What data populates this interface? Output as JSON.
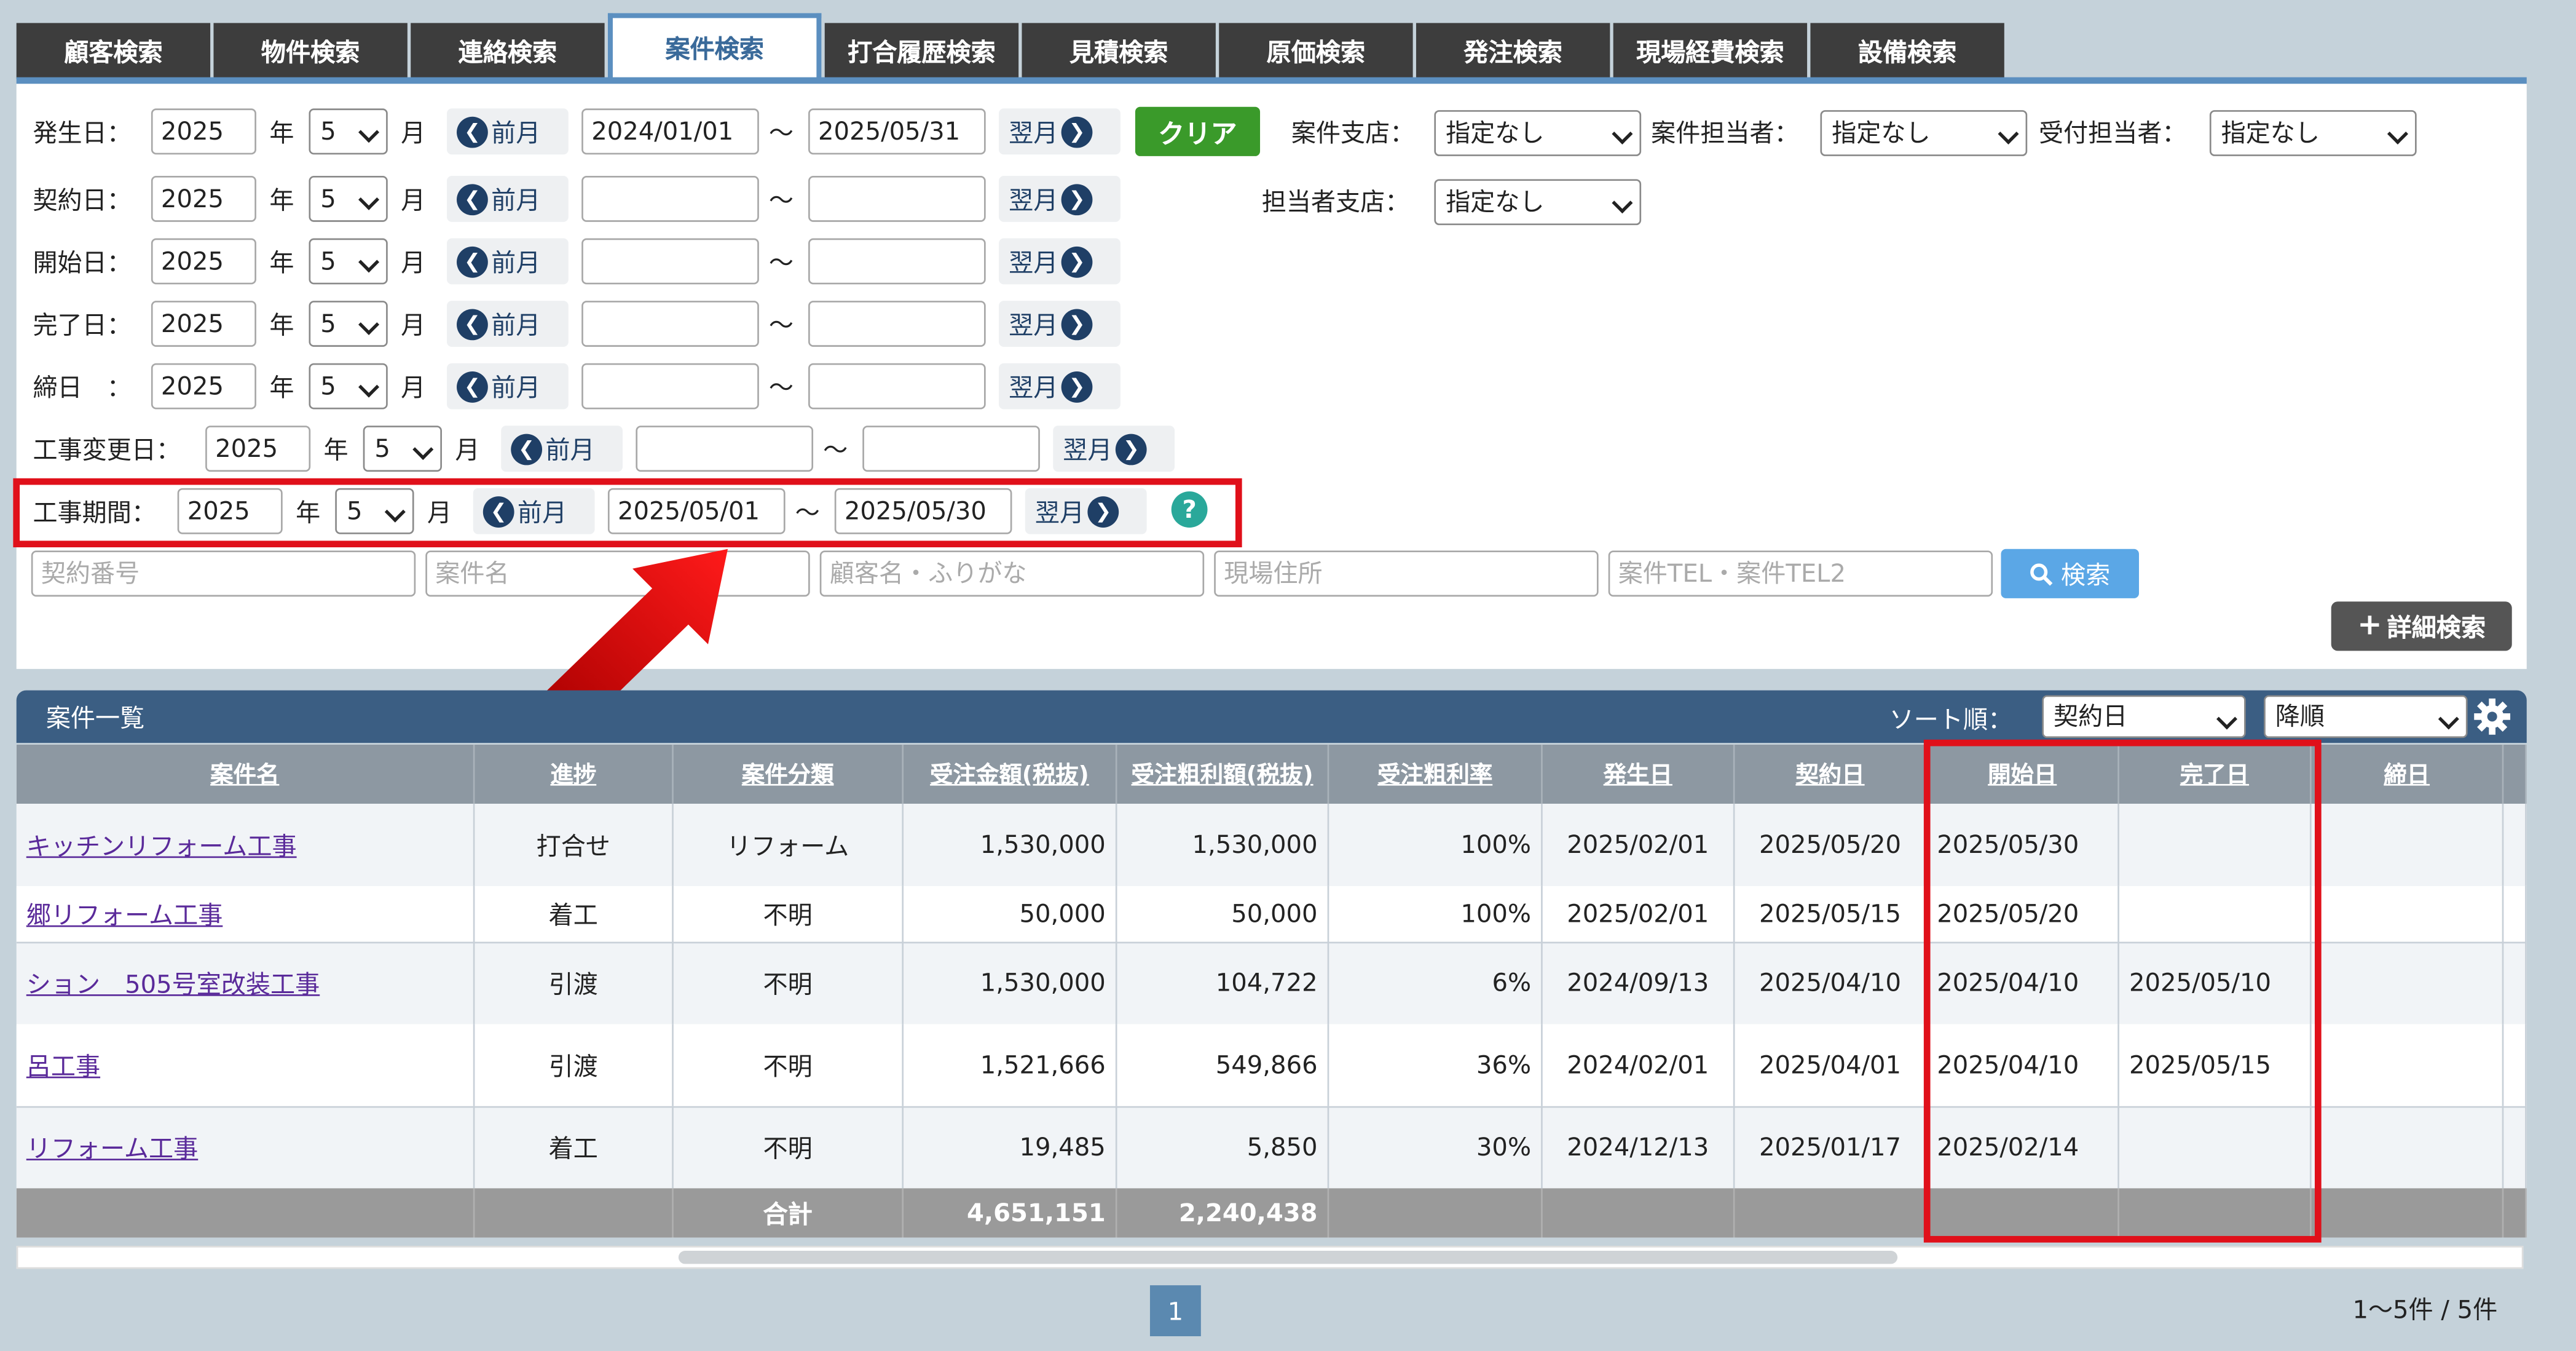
{
  "tabs": [
    "顧客検索",
    "物件検索",
    "連絡検索",
    "案件検索",
    "打合履歴検索",
    "見積検索",
    "原価検索",
    "発注検索",
    "現場経費検索",
    "設備検索"
  ],
  "active_tab": "案件検索",
  "search": {
    "year_unit": "年",
    "month_unit": "月",
    "prev_label": "前月",
    "next_label": "翌月",
    "tilde": "～",
    "clear_label": "クリア",
    "search_label": "検索",
    "detail_label": "詳細検索",
    "date_rows": [
      {
        "label": "発生日：",
        "year": "2025",
        "month": "5",
        "from": "2024/01/01",
        "to": "2025/05/31"
      },
      {
        "label": "契約日：",
        "year": "2025",
        "month": "5",
        "from": "",
        "to": ""
      },
      {
        "label": "開始日：",
        "year": "2025",
        "month": "5",
        "from": "",
        "to": ""
      },
      {
        "label": "完了日：",
        "year": "2025",
        "month": "5",
        "from": "",
        "to": ""
      },
      {
        "label": "締日　：",
        "year": "2025",
        "month": "5",
        "from": "",
        "to": ""
      },
      {
        "label": "工事変更日：",
        "year": "2025",
        "month": "5",
        "from": "",
        "to": ""
      },
      {
        "label": "工事期間：",
        "year": "2025",
        "month": "5",
        "from": "2025/05/01",
        "to": "2025/05/30"
      }
    ],
    "filters": {
      "branch_label": "案件支店：",
      "branch_value": "指定なし",
      "staff_label": "案件担当者：",
      "staff_value": "指定なし",
      "reception_label": "受付担当者：",
      "reception_value": "指定なし",
      "staff_branch_label": "担当者支店：",
      "staff_branch_value": "指定なし"
    },
    "placeholders": [
      "契約番号",
      "案件名",
      "顧客名・ふりがな",
      "現場住所",
      "案件TEL・案件TEL2"
    ]
  },
  "list": {
    "title": "案件一覧",
    "sort_label": "ソート順：",
    "sort_value": "契約日",
    "order_value": "降順",
    "columns": [
      "案件名",
      "進捗",
      "案件分類",
      "受注金額(税抜)",
      "受注粗利額(税抜)",
      "受注粗利率",
      "発生日",
      "契約日",
      "開始日",
      "完了日",
      "締日"
    ],
    "rows": [
      [
        "キッチンリフォーム工事",
        "打合せ",
        "リフォーム",
        "1,530,000",
        "1,530,000",
        "100%",
        "2025/02/01",
        "2025/05/20",
        "2025/05/30",
        "",
        ""
      ],
      [
        "郷リフォーム工事",
        "着工",
        "不明",
        "50,000",
        "50,000",
        "100%",
        "2025/02/01",
        "2025/05/15",
        "2025/05/20",
        "",
        ""
      ],
      [
        "ション　505号室改装工事",
        "引渡",
        "不明",
        "1,530,000",
        "104,722",
        "6%",
        "2024/09/13",
        "2025/04/10",
        "2025/04/10",
        "2025/05/10",
        ""
      ],
      [
        "呂工事",
        "引渡",
        "不明",
        "1,521,666",
        "549,866",
        "36%",
        "2024/02/01",
        "2025/04/01",
        "2025/04/10",
        "2025/05/15",
        ""
      ],
      [
        "リフォーム工事",
        "着工",
        "不明",
        "19,485",
        "5,850",
        "30%",
        "2024/12/13",
        "2025/01/17",
        "2025/02/14",
        "",
        ""
      ]
    ],
    "total_label": "合計",
    "total_amount": "4,651,151",
    "total_profit": "2,240,438"
  },
  "pagination": {
    "page": "1",
    "count": "1～5件 / 5件"
  },
  "colors": {
    "accent": "#5b8fc0",
    "header": "#3b5e83",
    "highlight": "#e0101a",
    "clear": "#3a9a2a"
  }
}
